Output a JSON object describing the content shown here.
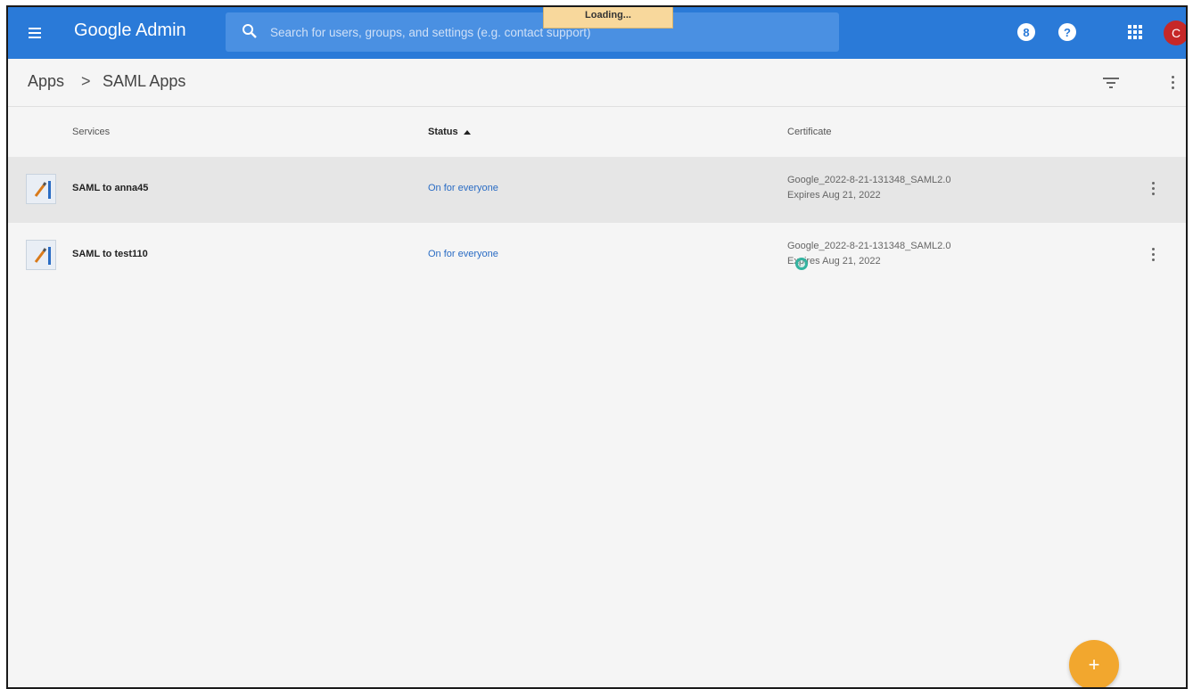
{
  "appbar": {
    "brand": "Google Admin",
    "search_placeholder": "Search for users, groups, and settings (e.g. contact support)",
    "loading_text": "Loading...",
    "badge_icon_label": "8",
    "help_icon_label": "?",
    "avatar_initial": "C",
    "brand_color": "#2a7ad8",
    "avatar_color": "#c62828"
  },
  "breadcrumb": {
    "root": "Apps",
    "separator": ">",
    "current": "SAML Apps"
  },
  "table": {
    "columns": {
      "services": "Services",
      "status": "Status",
      "certificate": "Certificate"
    },
    "sort_column": "Status",
    "sort_direction": "ascending",
    "rows": [
      {
        "name": "SAML to anna45",
        "status": "On for everyone",
        "cert_name": "Google_2022-8-21-131348_SAML2.0",
        "cert_expires": "Expires Aug 21, 2022"
      },
      {
        "name": "SAML to test110",
        "status": "On for everyone",
        "cert_name": "Google_2022-8-21-131348_SAML2.0",
        "cert_expires": "Expires Aug 21, 2022"
      }
    ]
  },
  "fab": {
    "label": "+",
    "color": "#f2a72e"
  }
}
